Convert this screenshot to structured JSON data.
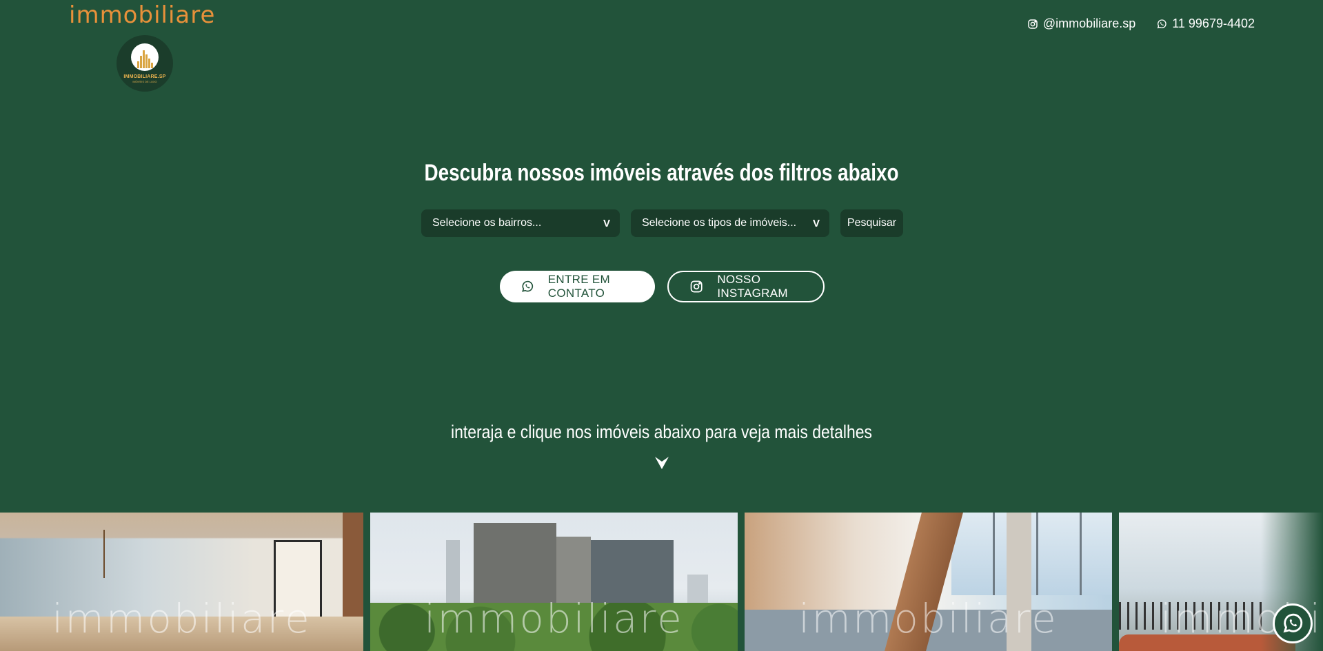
{
  "brand": {
    "wordmark": "immobiliare",
    "logo_text": "IMMOBILIARE.SP",
    "logo_subtext": "IMÓVEIS DE LUXO"
  },
  "header": {
    "instagram_handle": "@immobiliare.sp",
    "phone": "11 99679-4402"
  },
  "hero": {
    "headline": "Descubra nossos imóveis através dos filtros abaixo",
    "filters": {
      "bairros_placeholder": "Selecione os bairros...",
      "tipos_placeholder": "Selecione os tipos de imóveis...",
      "search_label": "Pesquisar",
      "chevron": "V"
    },
    "cta": {
      "contact_label": "ENTRE EM CONTATO",
      "instagram_label": "NOSSO INSTAGRAM"
    }
  },
  "listings": {
    "subheading": "interaja e clique nos imóveis abaixo para veja mais detalhes",
    "watermark": "immobiliare",
    "cards": [
      "listing-1",
      "listing-2",
      "listing-3",
      "listing-4"
    ]
  },
  "icons": {
    "instagram": "instagram-icon",
    "whatsapp": "whatsapp-icon",
    "chevron": "chevron-down-icon",
    "arrow": "arrow-down-icon"
  },
  "colors": {
    "background": "#22533a",
    "field": "#1a3c2a",
    "wordmark": "#e8913a",
    "text": "#ffffff"
  }
}
